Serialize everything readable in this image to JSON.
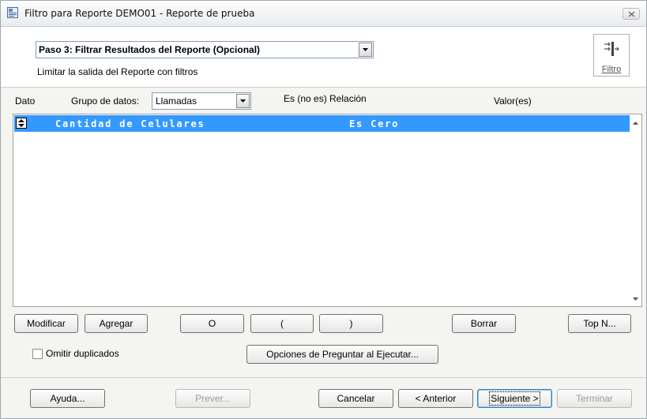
{
  "window": {
    "title": "Filtro para Reporte DEMO01 - Reporte de prueba"
  },
  "step": {
    "selected": "Paso 3: Filtrar Resultados del Reporte (Opcional)",
    "subtitle": "Limitar la salida del Reporte con filtros",
    "filter_label": "Filtro"
  },
  "header": {
    "dato": "Dato",
    "grupo_label": "Grupo de datos:",
    "grupo_value": "Llamadas",
    "relacion": "Es (no es) Relación",
    "valores": "Valor(es)"
  },
  "rows": [
    {
      "dato": "Cantidad de Celulares",
      "relacion": "Es Cero",
      "valor": ""
    }
  ],
  "buttons": {
    "modificar": "Modificar",
    "agregar": "Agregar",
    "o": "O",
    "paren_open": "(",
    "paren_close": ")",
    "borrar": "Borrar",
    "top_n": "Top N...",
    "omitir_duplicados": "Omitir duplicados",
    "opciones": "Opciones de Preguntar al Ejecutar...",
    "ayuda": "Ayuda...",
    "prever": "Prever...",
    "cancelar": "Cancelar",
    "anterior": "< Anterior",
    "siguiente": "Siguiente >",
    "terminar": "Terminar"
  },
  "colors": {
    "selection": "#3399ff",
    "window_bg": "#f4f4f0"
  }
}
